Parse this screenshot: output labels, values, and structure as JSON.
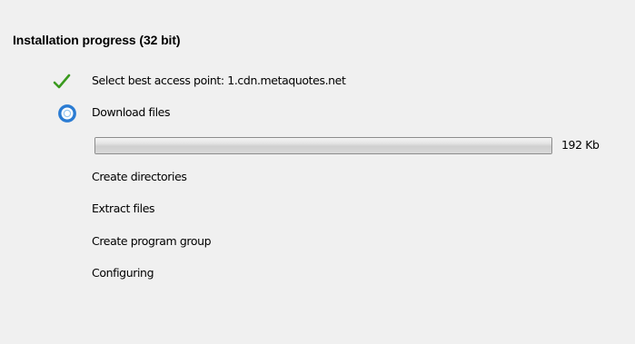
{
  "header": {
    "title": "Installation progress (32 bit)"
  },
  "steps": [
    {
      "label": "Select best access point: 1.cdn.metaquotes.net",
      "status": "done",
      "icon": "checkmark-icon"
    },
    {
      "label": "Download files",
      "status": "in-progress",
      "icon": "in-progress-icon"
    },
    {
      "label": "Create directories",
      "status": "pending"
    },
    {
      "label": "Extract files",
      "status": "pending"
    },
    {
      "label": "Create program group",
      "status": "pending"
    },
    {
      "label": "Configuring",
      "status": "pending"
    }
  ],
  "download": {
    "progress": 1.0,
    "size_label": "192 Kb"
  },
  "colors": {
    "background": "#f0f0f0",
    "check_green": "#3a9a1e",
    "progress_ring_blue": "#2b7cd3"
  }
}
